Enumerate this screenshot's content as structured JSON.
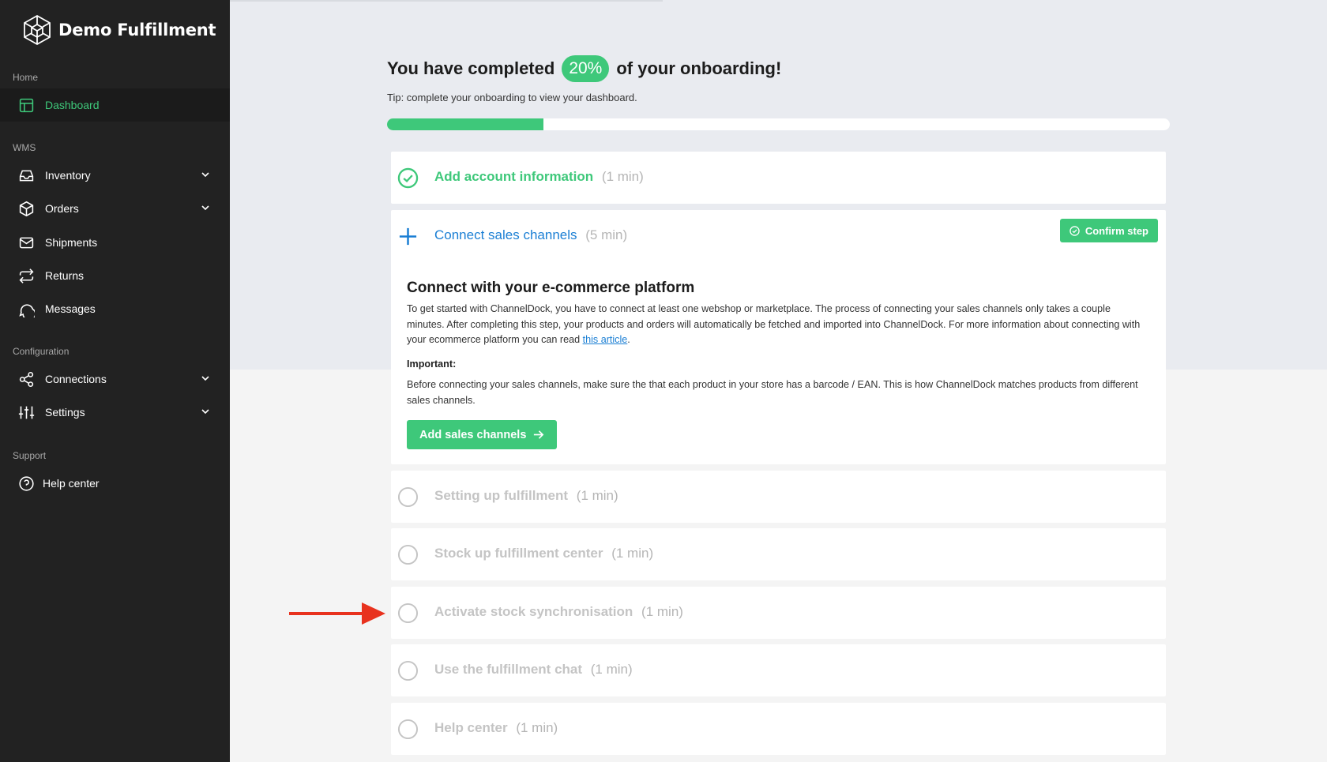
{
  "brand": {
    "name": "Demo Fulfillment",
    "logo_icon": "cube-network-logo-icon"
  },
  "sidebar": {
    "sections": [
      {
        "label": "Home"
      },
      {
        "label": "WMS"
      },
      {
        "label": "Configuration"
      },
      {
        "label": "Support"
      }
    ],
    "items": [
      {
        "label": "Dashboard",
        "icon": "dashboard-icon",
        "active": true
      },
      {
        "label": "Inventory",
        "icon": "inbox-icon",
        "has_submenu": true
      },
      {
        "label": "Orders",
        "icon": "box-icon",
        "has_submenu": true
      },
      {
        "label": "Shipments",
        "icon": "envelope-icon"
      },
      {
        "label": "Returns",
        "icon": "repeat-icon"
      },
      {
        "label": "Messages",
        "icon": "chat-icon"
      },
      {
        "label": "Connections",
        "icon": "share-icon",
        "has_submenu": true
      },
      {
        "label": "Settings",
        "icon": "sliders-icon",
        "has_submenu": true
      },
      {
        "label": "Help center",
        "icon": "help-icon"
      }
    ]
  },
  "onboarding": {
    "heading_prefix": "You have completed",
    "percent": "20%",
    "heading_suffix": "of your onboarding!",
    "tip": "Tip: complete your onboarding to view your dashboard.",
    "progress_fraction": 0.2,
    "steps": [
      {
        "title": "Add account information",
        "time": "(1 min)",
        "status": "done"
      },
      {
        "title": "Connect sales channels",
        "time": "(5 min)",
        "status": "open"
      },
      {
        "title": "Setting up fulfillment",
        "time": "(1 min)",
        "status": "todo"
      },
      {
        "title": "Stock up fulfillment center",
        "time": "(1 min)",
        "status": "todo"
      },
      {
        "title": "Activate stock synchronisation",
        "time": "(1 min)",
        "status": "todo"
      },
      {
        "title": "Use the fulfillment chat",
        "time": "(1 min)",
        "status": "todo"
      },
      {
        "title": "Help center",
        "time": "(1 min)",
        "status": "todo"
      }
    ],
    "open_panel": {
      "confirm_label": "Confirm step",
      "title": "Connect with your e-commerce platform",
      "body_before_link": "To get started with ChannelDock, you have to connect at least one webshop or marketplace. The process of connecting your sales channels only takes a couple minutes. After completing this step, your products and orders will automatically be fetched and imported into ChannelDock. For more information about connecting with your ecommerce platform you can read ",
      "link_text": "this article",
      "body_after_link": ".",
      "important_label": "Important:",
      "important_body": "Before connecting your sales channels, make sure the that each product in your store has a barcode / EAN. This is how ChannelDock matches products from different sales channels.",
      "button_label": "Add sales channels"
    }
  },
  "colors": {
    "accent": "#3ec87a",
    "link": "#1b7fd4",
    "sidebar": "#222222",
    "annotation": "#e8321e"
  }
}
